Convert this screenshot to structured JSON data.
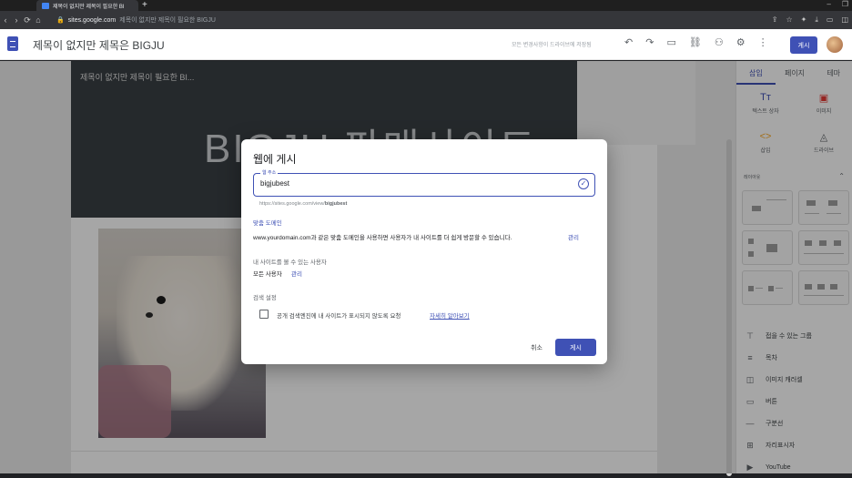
{
  "browser": {
    "tab_title": "제목이 없지만 제목이 필요한 BI",
    "new_tab": "+",
    "url_domain": "sites.google.com",
    "url_rest": "제목이 없지만 제목이 필요한 BIGJU"
  },
  "app": {
    "site_title": "제목이 없지만 제목은 BIGJU",
    "save_status": "모든 변경사항이 드라이브에 저장됨",
    "publish_label": "게시"
  },
  "page": {
    "banner_small": "제목이 없지만 제목이 필요한 BI...",
    "banner_big": "BIGJU 판매사이트"
  },
  "sidebar": {
    "tabs": [
      "삽입",
      "페이지",
      "테마"
    ],
    "insert_items": [
      {
        "icon": "Tт",
        "label": "텍스트 상자"
      },
      {
        "icon": "▣",
        "label": "이미지"
      },
      {
        "icon": "<>",
        "label": "삽입"
      },
      {
        "icon": "◬",
        "label": "드라이브"
      }
    ],
    "layouts_header": "레이아웃",
    "list": [
      {
        "icon": "⊤",
        "label": "접을 수 있는 그룹"
      },
      {
        "icon": "≡",
        "label": "목차"
      },
      {
        "icon": "◫",
        "label": "이미지 캐러셀"
      },
      {
        "icon": "▭",
        "label": "버튼"
      },
      {
        "icon": "—",
        "label": "구분선"
      },
      {
        "icon": "⊞",
        "label": "자리표시자"
      },
      {
        "icon": "▶",
        "label": "YouTube"
      }
    ]
  },
  "dialog": {
    "title": "웹에 게시",
    "field_label": "웹 주소",
    "field_value": "bigjubest",
    "url_prefix": "https://sites.google.com/view/",
    "url_slug": "bigjubest",
    "custom_domain": "맞춤 도메인",
    "custom_desc": "www.yourdomain.com과 같은 맞춤 도메인을 사용하면 사용자가 내 사이트를 더 쉽게 방문할 수 있습니다.",
    "manage": "관리",
    "viewers_header": "내 사이트를 볼 수 있는 사용자",
    "viewers_value": "모든 사용자",
    "search_header": "검색 설정",
    "checkbox_label": "공개 검색엔진에 내 사이트가 표시되지 않도록 요청",
    "learn_more": "자세히 알아보기",
    "cancel": "취소",
    "publish": "게시"
  }
}
